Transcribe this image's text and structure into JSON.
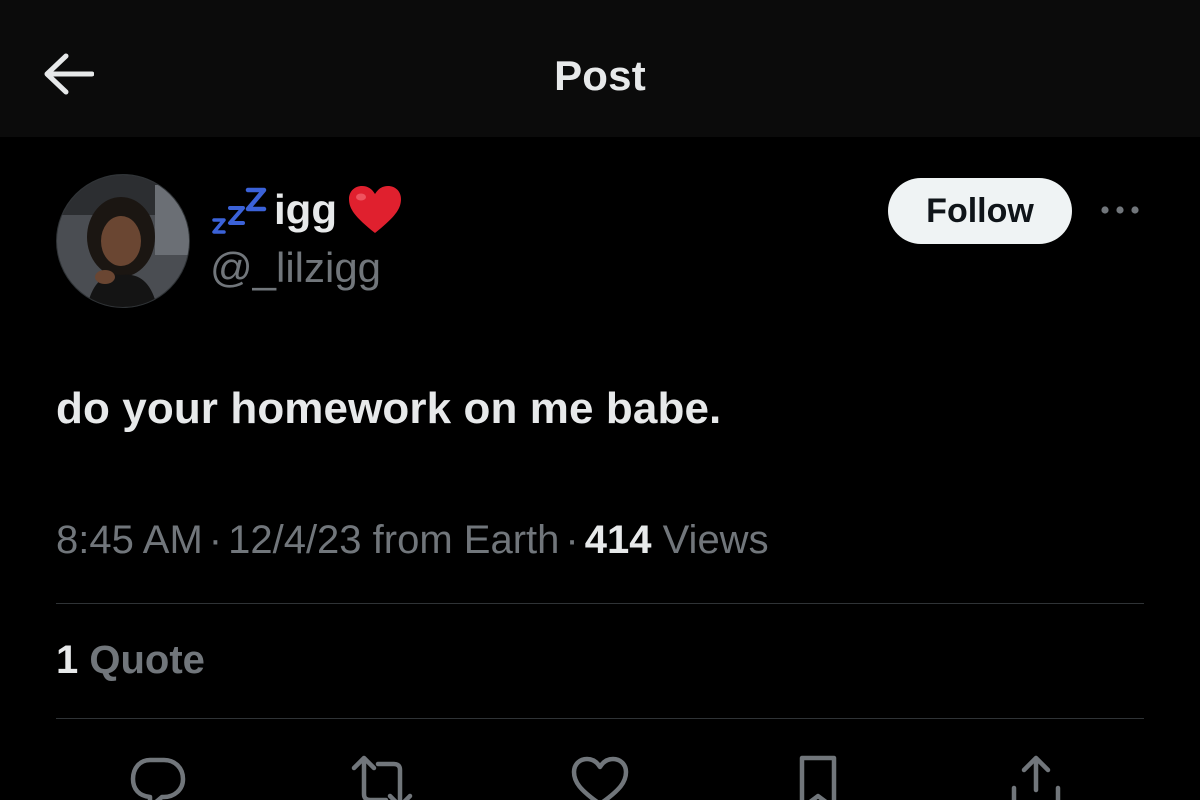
{
  "header": {
    "title": "Post"
  },
  "author": {
    "display_name": "igg",
    "handle": "@_lilzigg",
    "name_prefix_icon": "sleeping-zzz-emoji",
    "name_suffix_icon": "red-heart-emoji"
  },
  "follow_label": "Follow",
  "post": {
    "text": "do your homework on me babe."
  },
  "meta": {
    "time": "8:45 AM",
    "date_and_source": "12/4/23 from Earth",
    "views_count": "414",
    "views_label": "Views",
    "separator": "·"
  },
  "engagement": {
    "quotes_count": "1",
    "quotes_label": "Quote"
  },
  "actions": [
    "reply-icon",
    "repost-icon",
    "like-icon",
    "bookmark-icon",
    "share-icon"
  ],
  "colors": {
    "background": "#000000",
    "header_background": "#0b0b0b",
    "primary_text": "#e7e9ea",
    "secondary_text": "#71767b",
    "divider": "#2f3336",
    "follow_button_bg": "#eff3f4",
    "zzz_blue": "#3b62d8",
    "heart_red": "#e0202e"
  }
}
